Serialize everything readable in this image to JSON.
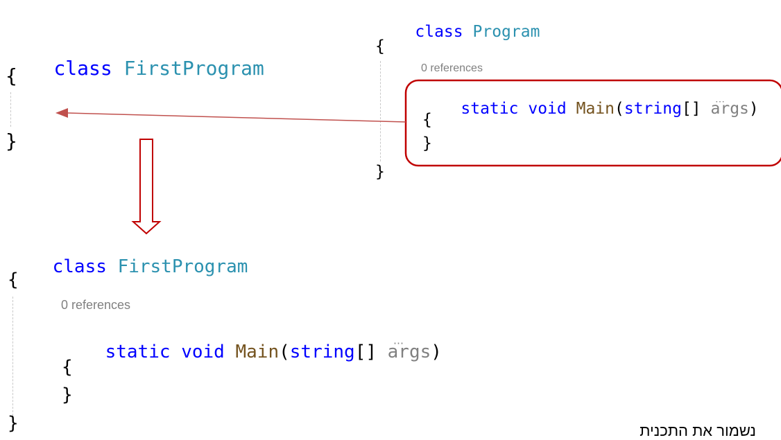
{
  "snippet_top_left": {
    "line1": {
      "keyword": "class",
      "name": "FirstProgram"
    },
    "open_brace": "{",
    "close_brace": "}"
  },
  "snippet_top_right": {
    "line1": {
      "keyword": "class",
      "name": "Program"
    },
    "open_brace": "{",
    "references": "0 references",
    "method": {
      "static": "static",
      "void": "void",
      "name": "Main",
      "open_paren": "(",
      "param_type": "string",
      "brackets": "[]",
      "param_name": "args",
      "close_paren": ")"
    },
    "method_open_brace": "{",
    "method_close_brace": "}",
    "close_brace": "}"
  },
  "snippet_bottom": {
    "line1": {
      "keyword": "class",
      "name": "FirstProgram"
    },
    "open_brace": "{",
    "references": "0 references",
    "method": {
      "static": "static",
      "void": "void",
      "name": "Main",
      "open_paren": "(",
      "param_type": "string",
      "brackets": "[]",
      "param_name": "args",
      "close_paren": ")"
    },
    "method_open_brace": "{",
    "method_close_brace": "}",
    "close_brace": "}"
  },
  "caption": "נשמור את התכנית",
  "colors": {
    "keyword": "#0000ff",
    "class_name": "#2b91af",
    "method_name": "#74531f",
    "param_name": "#808080",
    "highlight_box": "#c00000",
    "arrow": "#c0504d"
  }
}
